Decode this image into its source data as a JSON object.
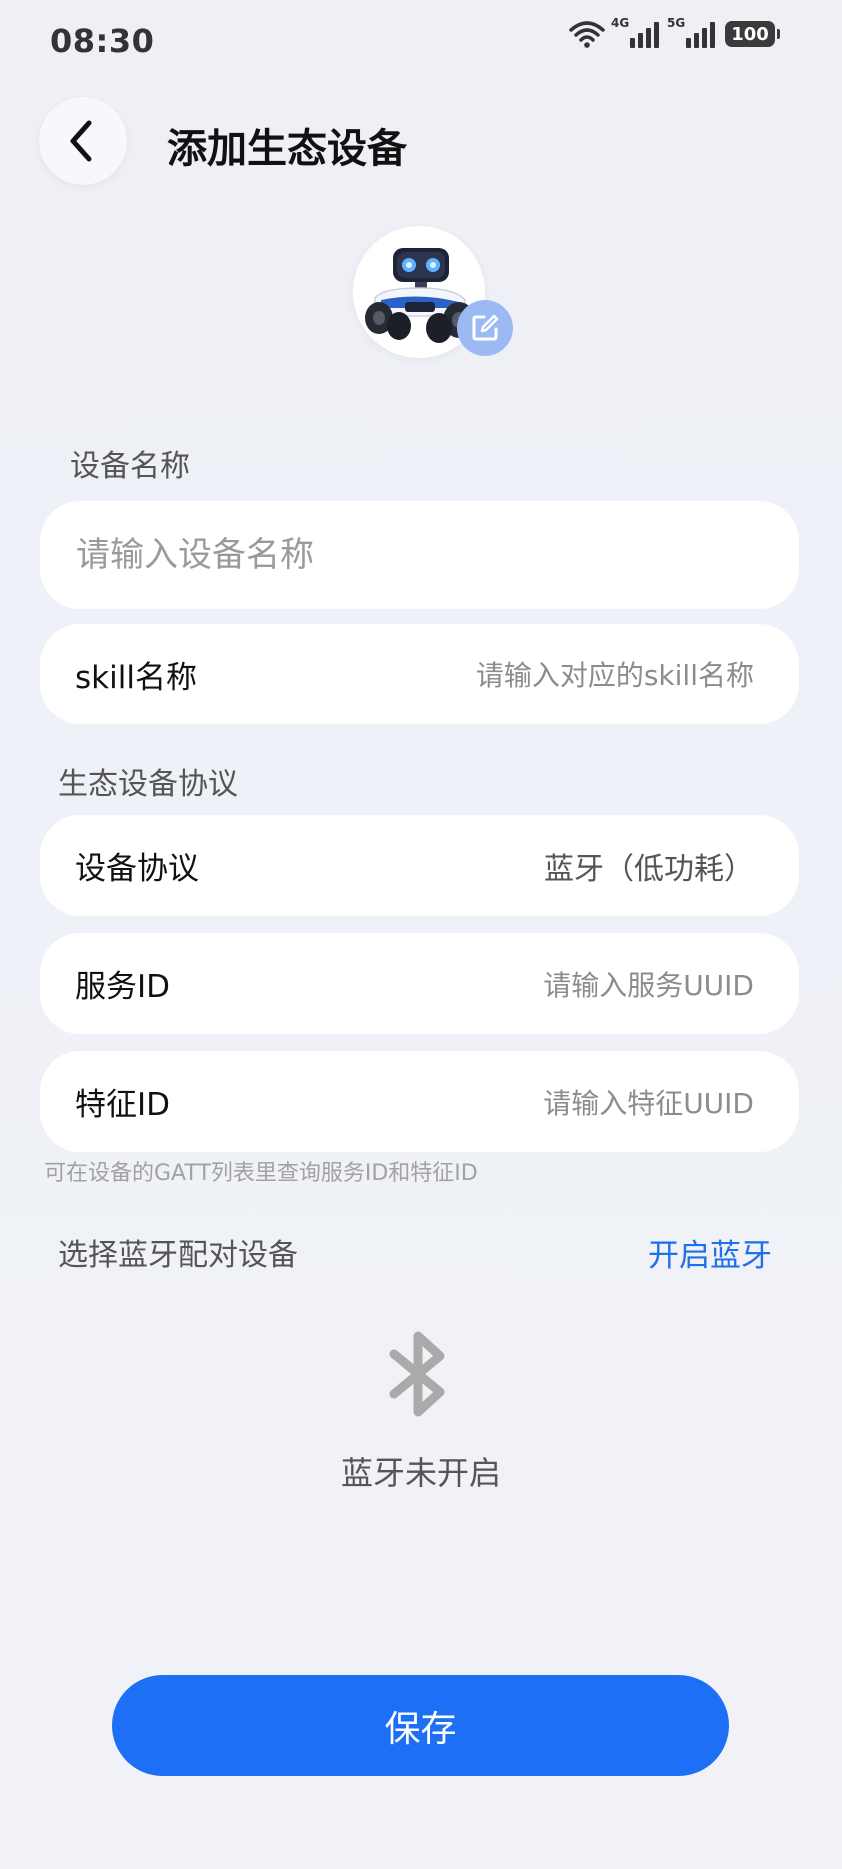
{
  "status_bar": {
    "time": "08:30",
    "network_4g": "4G",
    "network_5g": "5G",
    "battery": "100",
    "icons": [
      "wifi-icon",
      "signal-4g-icon",
      "signal-5g-icon",
      "battery-icon"
    ]
  },
  "header": {
    "title": "添加生态设备",
    "back_icon": "chevron-left-icon"
  },
  "avatar": {
    "image": "robot-car-image",
    "edit_icon": "edit-icon"
  },
  "device_name": {
    "section_label": "设备名称",
    "placeholder": "请输入设备名称",
    "value": ""
  },
  "skill": {
    "label": "skill名称",
    "placeholder": "请输入对应的skill名称"
  },
  "protocol_section": {
    "section_label": "生态设备协议",
    "protocol_label": "设备协议",
    "protocol_value": "蓝牙（低功耗）",
    "service_id_label": "服务ID",
    "service_id_placeholder": "请输入服务UUID",
    "feature_id_label": "特征ID",
    "feature_id_placeholder": "请输入特征UUID",
    "hint": "可在设备的GATT列表里查询服务ID和特征ID"
  },
  "bluetooth": {
    "section_label": "选择蓝牙配对设备",
    "open_label": "开启蓝牙",
    "status_text": "蓝牙未开启",
    "icon": "bluetooth-icon"
  },
  "footer": {
    "save_label": "保存"
  },
  "colors": {
    "accent": "#1d6ff5",
    "link": "#1f6fe8",
    "background": "#eef0f6"
  }
}
